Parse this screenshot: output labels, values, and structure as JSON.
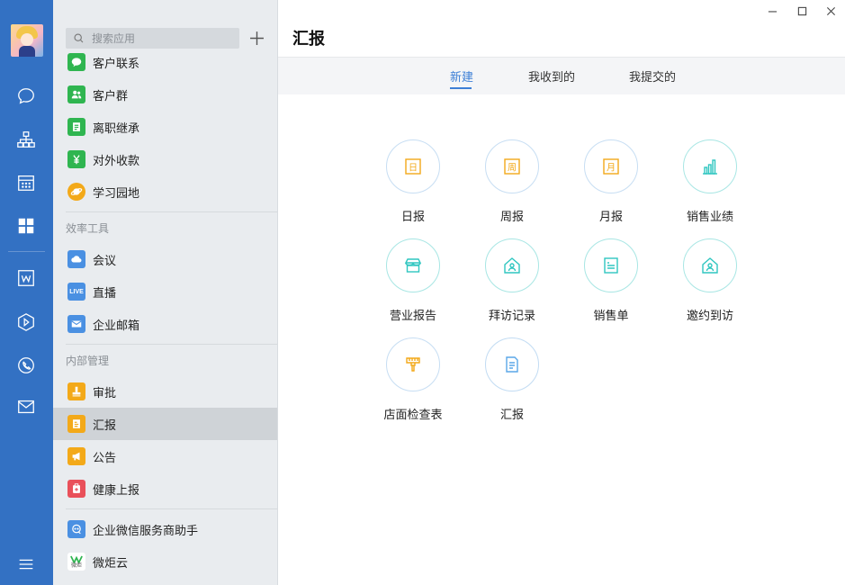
{
  "search": {
    "placeholder": "搜索应用"
  },
  "sidebar": {
    "items_top": [
      {
        "label": "客户联系",
        "color": "#2fb550"
      },
      {
        "label": "客户群",
        "color": "#2fb550"
      },
      {
        "label": "离职继承",
        "color": "#2fb550"
      },
      {
        "label": "对外收款",
        "color": "#2fb550"
      },
      {
        "label": "学习园地",
        "color": "#f3a919"
      }
    ],
    "section_efficiency": "效率工具",
    "items_efficiency": [
      {
        "label": "会议",
        "color": "#4a90e2"
      },
      {
        "label": "直播",
        "color": "#4a90e2",
        "icon_text": "LIVE"
      },
      {
        "label": "企业邮箱",
        "color": "#4a90e2"
      }
    ],
    "section_internal": "内部管理",
    "items_internal": [
      {
        "label": "审批",
        "color": "#f3a919"
      },
      {
        "label": "汇报",
        "color": "#f3a919"
      },
      {
        "label": "公告",
        "color": "#f3a919"
      },
      {
        "label": "健康上报",
        "color": "#e9505a"
      }
    ],
    "items_bottom": [
      {
        "label": "企业微信服务商助手",
        "color": "#4a90e2"
      },
      {
        "label": "微炬云",
        "color": "#ffffff",
        "icon_text": "微炬"
      }
    ]
  },
  "main": {
    "title": "汇报",
    "tabs": [
      "新建",
      "我收到的",
      "我提交的"
    ],
    "active_tab": "新建",
    "report_types": [
      {
        "label": "日报",
        "icon_text": "日",
        "color": "#f3a919"
      },
      {
        "label": "周报",
        "icon_text": "周",
        "color": "#f3a919"
      },
      {
        "label": "月报",
        "icon_text": "月",
        "color": "#f3a919"
      },
      {
        "label": "销售业绩",
        "color": "#2fc6c0"
      },
      {
        "label": "营业报告",
        "color": "#2fc6c0"
      },
      {
        "label": "拜访记录",
        "color": "#2fc6c0"
      },
      {
        "label": "销售单",
        "color": "#2fc6c0"
      },
      {
        "label": "邀约到访",
        "color": "#2fc6c0"
      },
      {
        "label": "店面检查表",
        "color": "#f3a919"
      },
      {
        "label": "汇报",
        "color": "#5aa7e8"
      }
    ]
  },
  "colors": {
    "rail": "#3371c3",
    "accent": "#3d7fd6",
    "active_item": "#cfd3d7"
  }
}
